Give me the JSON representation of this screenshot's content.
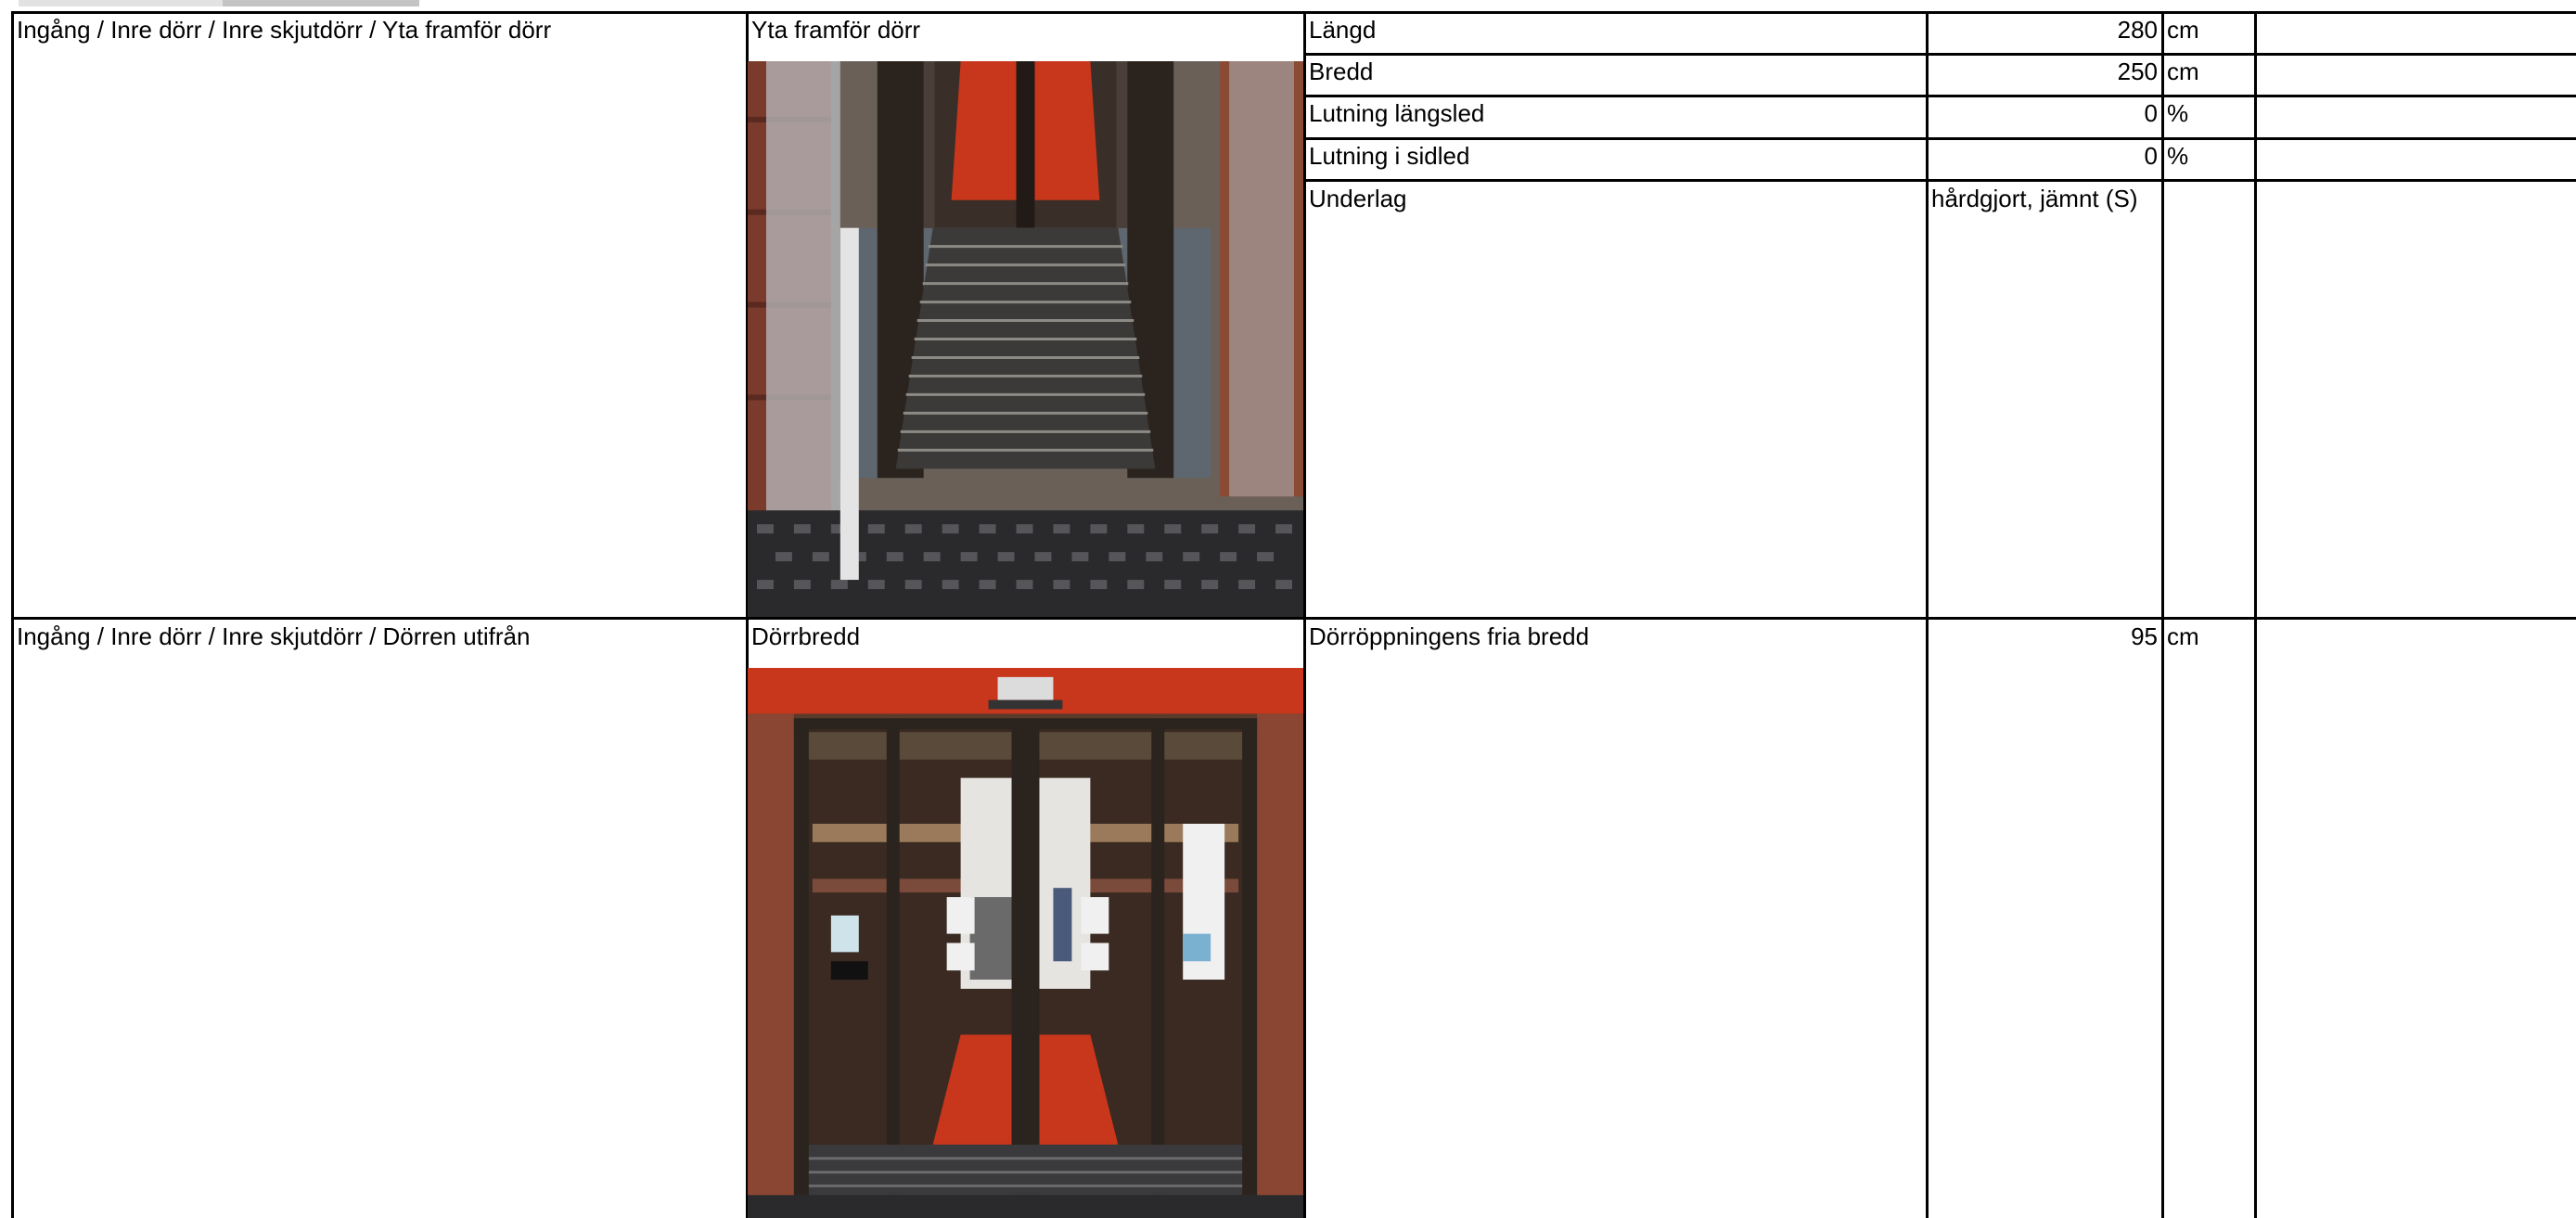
{
  "rows": [
    {
      "path": "Ingång / Inre dörr / Inre skjutdörr  / Yta framför dörr",
      "image_caption": "Yta framför dörr",
      "image_icon": "photo-entrance-floor-mats",
      "measurements": [
        {
          "label": "Längd",
          "value": "280",
          "unit": "cm"
        },
        {
          "label": "Bredd",
          "value": "250",
          "unit": "cm"
        },
        {
          "label": "Lutning längsled",
          "value": "0",
          "unit": "%"
        },
        {
          "label": "Lutning i sidled",
          "value": "0",
          "unit": "%"
        },
        {
          "label": "Underlag",
          "value": "hårdgjort, jämnt (S)",
          "unit": ""
        }
      ]
    },
    {
      "path": "Ingång / Inre dörr / Inre skjutdörr  / Dörren utifrån",
      "image_caption": "Dörrbredd",
      "image_icon": "photo-sliding-glass-door",
      "measurements": [
        {
          "label": "Dörröppningens fria bredd",
          "value": "95",
          "unit": "cm"
        }
      ]
    }
  ],
  "colors": {
    "grid_line": "#000000",
    "photo_red_floor": "#c8361c",
    "photo_door_frame": "#2b241e"
  }
}
